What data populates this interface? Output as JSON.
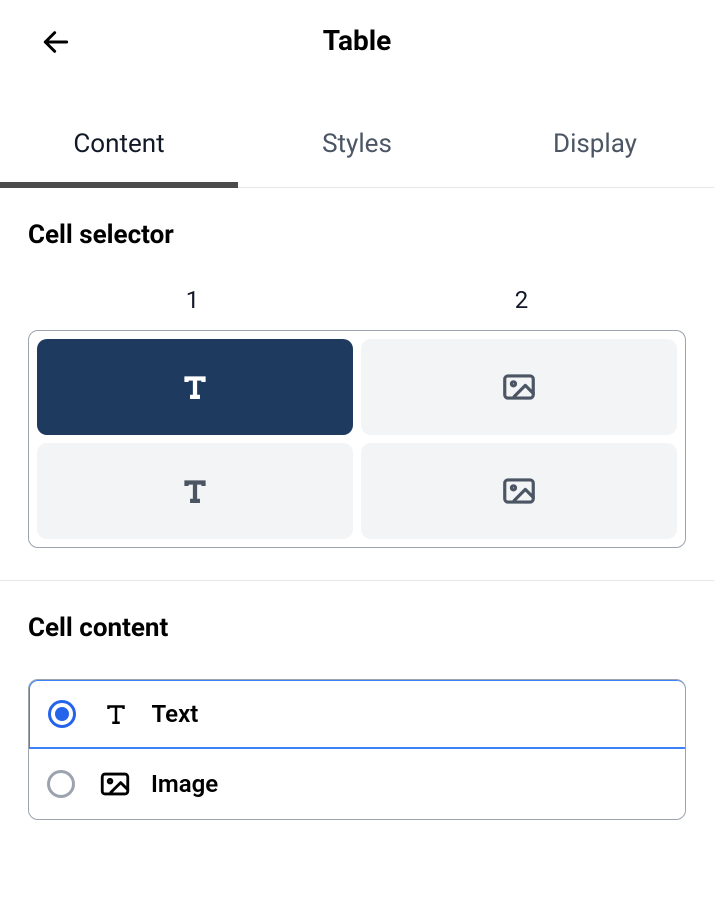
{
  "header": {
    "title": "Table"
  },
  "tabs": [
    {
      "label": "Content",
      "active": true
    },
    {
      "label": "Styles",
      "active": false
    },
    {
      "label": "Display",
      "active": false
    }
  ],
  "cellSelector": {
    "title": "Cell selector",
    "columns": [
      "1",
      "2"
    ],
    "cells": [
      [
        {
          "type": "text",
          "selected": true
        },
        {
          "type": "image",
          "selected": false
        }
      ],
      [
        {
          "type": "text",
          "selected": false
        },
        {
          "type": "image",
          "selected": false
        }
      ]
    ]
  },
  "cellContent": {
    "title": "Cell content",
    "options": [
      {
        "value": "text",
        "label": "Text",
        "selected": true
      },
      {
        "value": "image",
        "label": "Image",
        "selected": false
      }
    ]
  }
}
